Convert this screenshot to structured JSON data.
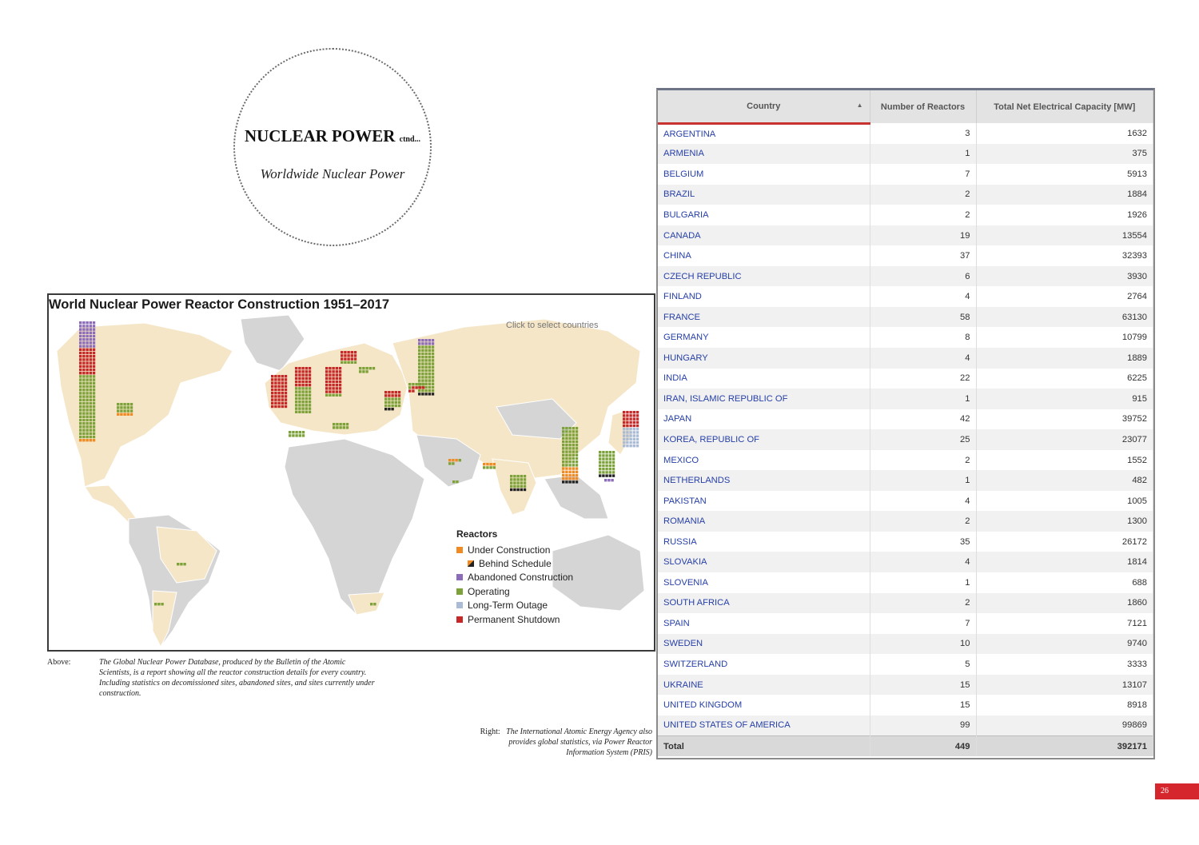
{
  "header": {
    "title": "NUCLEAR POWER",
    "title_suffix": "ctnd...",
    "subtitle": "Worldwide Nuclear Power"
  },
  "map_figure": {
    "title": "World Nuclear Power Reactor Construction 1951–2017",
    "hint": "Click to select countries",
    "legend": {
      "title": "Reactors",
      "items": [
        {
          "label": "Under Construction",
          "color": "#f08a22"
        },
        {
          "label": "Behind Schedule",
          "color": "#222222"
        },
        {
          "label": "Abandoned Construction",
          "color": "#8c6bb8"
        },
        {
          "label": "Operating",
          "color": "#7da23a"
        },
        {
          "label": "Long-Term Outage",
          "color": "#aabbd6"
        },
        {
          "label": "Permanent Shutdown",
          "color": "#c62828"
        }
      ]
    },
    "colors": {
      "ocean": "#ffffff",
      "nuclear_land": "#f5e6c8",
      "other_land": "#d5d5d5"
    }
  },
  "captions": {
    "above_label": "Above:",
    "above_text": "The Global Nuclear Power Database, produced by the Bulletin of the Atomic Scientists, is a report showing all the reactor construction details for every country. Including statistics on decomissioned sites, abandoned sites, and sites currently under construction.",
    "right_label": "Right:",
    "right_text": "The International Atomic Energy Agency also provides global statistics, via Power Reactor Information System (PRIS)"
  },
  "pris_table": {
    "headers": {
      "country": "Country",
      "sort_indicator": "▲",
      "reactors": "Number of Reactors",
      "capacity": "Total Net Electrical Capacity [MW]"
    },
    "rows": [
      {
        "country": "ARGENTINA",
        "reactors": "3",
        "capacity": "1632"
      },
      {
        "country": "ARMENIA",
        "reactors": "1",
        "capacity": "375"
      },
      {
        "country": "BELGIUM",
        "reactors": "7",
        "capacity": "5913"
      },
      {
        "country": "BRAZIL",
        "reactors": "2",
        "capacity": "1884"
      },
      {
        "country": "BULGARIA",
        "reactors": "2",
        "capacity": "1926"
      },
      {
        "country": "CANADA",
        "reactors": "19",
        "capacity": "13554"
      },
      {
        "country": "CHINA",
        "reactors": "37",
        "capacity": "32393"
      },
      {
        "country": "CZECH REPUBLIC",
        "reactors": "6",
        "capacity": "3930"
      },
      {
        "country": "FINLAND",
        "reactors": "4",
        "capacity": "2764"
      },
      {
        "country": "FRANCE",
        "reactors": "58",
        "capacity": "63130"
      },
      {
        "country": "GERMANY",
        "reactors": "8",
        "capacity": "10799"
      },
      {
        "country": "HUNGARY",
        "reactors": "4",
        "capacity": "1889"
      },
      {
        "country": "INDIA",
        "reactors": "22",
        "capacity": "6225"
      },
      {
        "country": "IRAN, ISLAMIC REPUBLIC OF",
        "reactors": "1",
        "capacity": "915"
      },
      {
        "country": "JAPAN",
        "reactors": "42",
        "capacity": "39752"
      },
      {
        "country": "KOREA, REPUBLIC OF",
        "reactors": "25",
        "capacity": "23077"
      },
      {
        "country": "MEXICO",
        "reactors": "2",
        "capacity": "1552"
      },
      {
        "country": "NETHERLANDS",
        "reactors": "1",
        "capacity": "482"
      },
      {
        "country": "PAKISTAN",
        "reactors": "4",
        "capacity": "1005"
      },
      {
        "country": "ROMANIA",
        "reactors": "2",
        "capacity": "1300"
      },
      {
        "country": "RUSSIA",
        "reactors": "35",
        "capacity": "26172"
      },
      {
        "country": "SLOVAKIA",
        "reactors": "4",
        "capacity": "1814"
      },
      {
        "country": "SLOVENIA",
        "reactors": "1",
        "capacity": "688"
      },
      {
        "country": "SOUTH AFRICA",
        "reactors": "2",
        "capacity": "1860"
      },
      {
        "country": "SPAIN",
        "reactors": "7",
        "capacity": "7121"
      },
      {
        "country": "SWEDEN",
        "reactors": "10",
        "capacity": "9740"
      },
      {
        "country": "SWITZERLAND",
        "reactors": "5",
        "capacity": "3333"
      },
      {
        "country": "UKRAINE",
        "reactors": "15",
        "capacity": "13107"
      },
      {
        "country": "UNITED KINGDOM",
        "reactors": "15",
        "capacity": "8918"
      },
      {
        "country": "UNITED STATES OF AMERICA",
        "reactors": "99",
        "capacity": "99869"
      }
    ],
    "total": {
      "label": "Total",
      "reactors": "449",
      "capacity": "392171"
    }
  },
  "page_number": "26"
}
